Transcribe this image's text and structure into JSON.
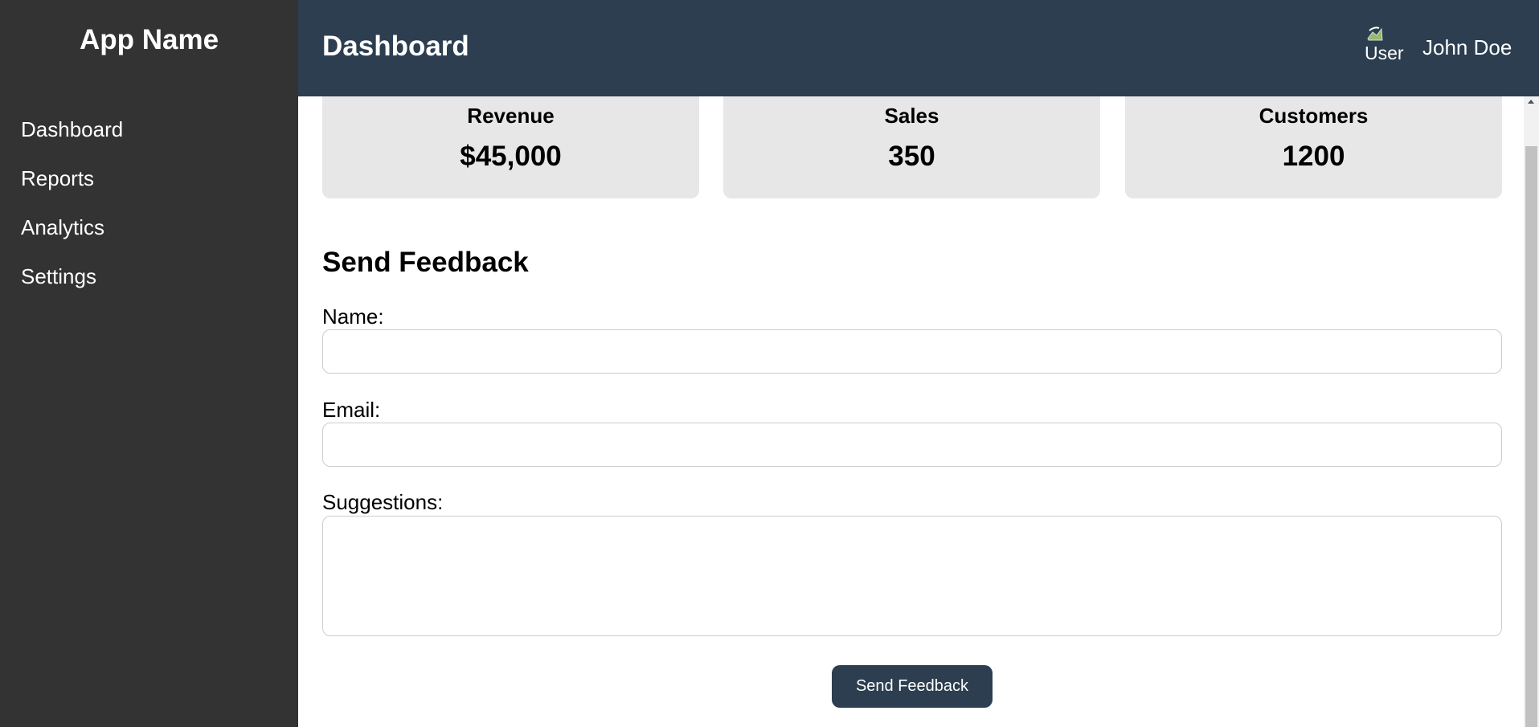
{
  "sidebar": {
    "app_name": "App Name",
    "items": [
      {
        "label": "Dashboard"
      },
      {
        "label": "Reports"
      },
      {
        "label": "Analytics"
      },
      {
        "label": "Settings"
      }
    ]
  },
  "header": {
    "title": "Dashboard",
    "avatar_alt": "User",
    "user_name": "John Doe"
  },
  "stats": [
    {
      "label": "Revenue",
      "value": "$45,000"
    },
    {
      "label": "Sales",
      "value": "350"
    },
    {
      "label": "Customers",
      "value": "1200"
    }
  ],
  "feedback": {
    "title": "Send Feedback",
    "name_label": "Name:",
    "name_value": "",
    "email_label": "Email:",
    "email_value": "",
    "suggestions_label": "Suggestions:",
    "suggestions_value": "",
    "submit_label": "Send Feedback"
  },
  "colors": {
    "sidebar_bg": "#333333",
    "header_bg": "#2c3e50",
    "card_bg": "#e7e7e7",
    "button_bg": "#2c3e50"
  },
  "icons": {
    "avatar": "broken-image-icon"
  }
}
